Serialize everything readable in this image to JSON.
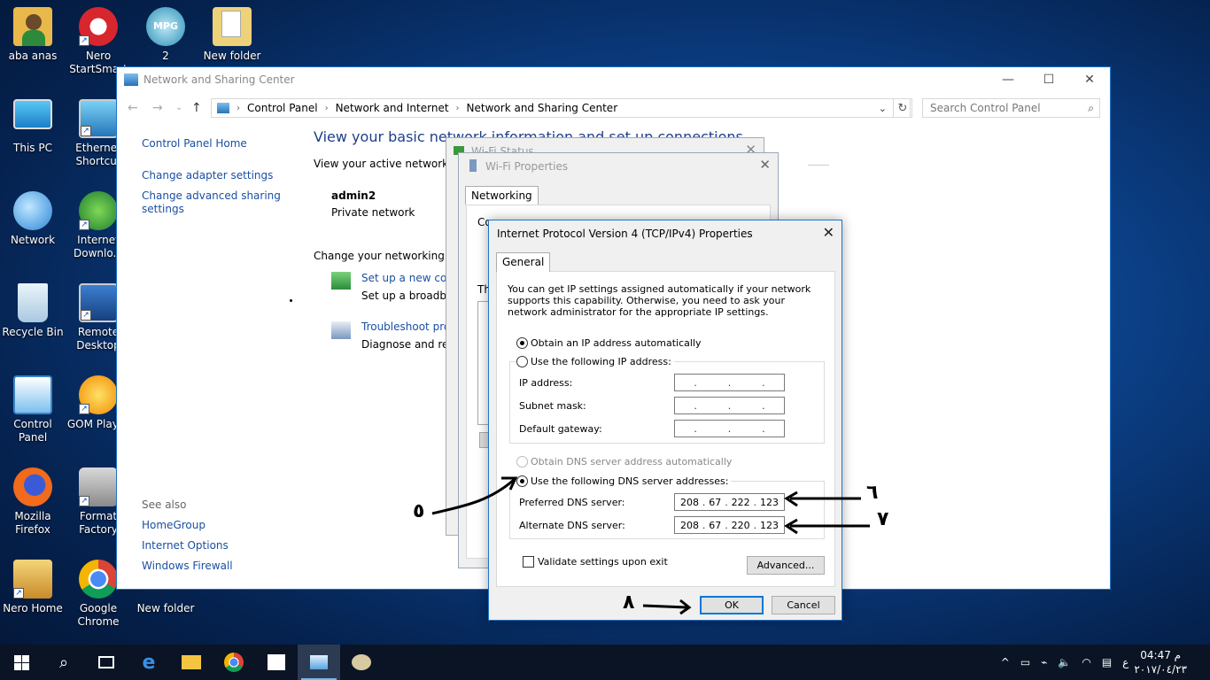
{
  "desktop": {
    "icons": [
      {
        "label": "aba anas"
      },
      {
        "label": "Nero StartSmart"
      },
      {
        "label": "2"
      },
      {
        "label": "New folder"
      },
      {
        "label": "This PC"
      },
      {
        "label": "Ethernet Shortcut"
      },
      {
        "label": "Network"
      },
      {
        "label": "Internet Downlo..."
      },
      {
        "label": "Recycle Bin"
      },
      {
        "label": "Remote Desktop"
      },
      {
        "label": "Control Panel"
      },
      {
        "label": "GOM Player"
      },
      {
        "label": "Mozilla Firefox"
      },
      {
        "label": "Format Factory"
      },
      {
        "label": "Nero Home"
      },
      {
        "label": "Google Chrome"
      },
      {
        "label": "New folder"
      }
    ],
    "mpg_badge": "MPG"
  },
  "main_window": {
    "title": "Network and Sharing Center",
    "controls": {
      "minimize": "—",
      "maximize": "☐",
      "close": "✕"
    },
    "breadcrumb": [
      "Control Panel",
      "Network and Internet",
      "Network and Sharing Center"
    ],
    "search_placeholder": "Search Control Panel",
    "sidebar": {
      "home": "Control Panel Home",
      "adapter": "Change adapter settings",
      "advanced_1": "Change advanced sharing",
      "advanced_2": "settings",
      "see_also": "See also",
      "homegroup": "HomeGroup",
      "internet_options": "Internet Options",
      "firewall": "Windows Firewall"
    },
    "heading": "View your basic network information and set up connections",
    "active_networks": "View your active networks",
    "network_name": "admin2",
    "network_type": "Private network",
    "change_settings": "Change your networking set",
    "tasks": [
      {
        "link": "Set up a new conn",
        "desc": "Set up a broadban"
      },
      {
        "link": "Troubleshoot prob",
        "desc": "Diagnose and repa"
      }
    ]
  },
  "wifi_status": {
    "title": "Wi-Fi Status"
  },
  "wifi_props": {
    "title": "Wi-Fi Properties",
    "tab": "Networking",
    "connect_label": "Co",
    "this_label": "Th"
  },
  "ipv4": {
    "title": "Internet Protocol Version 4 (TCP/IPv4) Properties",
    "tab": "General",
    "description": "You can get IP settings assigned automatically if your network supports this capability. Otherwise, you need to ask your network administrator for the appropriate IP settings.",
    "ip_auto": "Obtain an IP address automatically",
    "ip_manual": "Use the following IP address:",
    "ip_address_label": "IP address:",
    "subnet_label": "Subnet mask:",
    "gateway_label": "Default gateway:",
    "dns_auto": "Obtain DNS server address automatically",
    "dns_manual": "Use the following DNS server addresses:",
    "preferred_label": "Preferred DNS server:",
    "alternate_label": "Alternate DNS server:",
    "preferred": [
      "208",
      "67",
      "222",
      "123"
    ],
    "alternate": [
      "208",
      "67",
      "220",
      "123"
    ],
    "validate": "Validate settings upon exit",
    "advanced_btn": "Advanced...",
    "ok_btn": "OK",
    "cancel_btn": "Cancel"
  },
  "annotations": {
    "step5": "٥",
    "step6": "٦",
    "step7": "٧",
    "step8": "٨"
  },
  "taskbar": {
    "time": "04:47 م",
    "date": "٢٠١٧/٠٤/٢٣",
    "lang": "ع"
  }
}
